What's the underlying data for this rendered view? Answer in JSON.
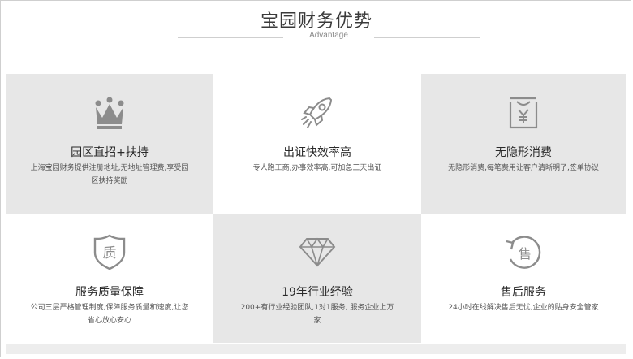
{
  "header": {
    "title": "宝园财务优势",
    "subtitle": "Advantage"
  },
  "features": [
    {
      "title": "园区直招+扶持",
      "desc": "上海宝园财务提供注册地址,无地址管理费,享受园区扶持奖励",
      "icon": "crown-icon"
    },
    {
      "title": "出证快效率高",
      "desc": "专人跑工商,办事效率高,可加急三天出证",
      "icon": "rocket-icon"
    },
    {
      "title": "无隐形消费",
      "desc": "无隐形消费,每笔费用让客户清晰明了,签单协议",
      "icon": "yen-receipt-icon"
    },
    {
      "title": "服务质量保障",
      "desc": "公司三层严格管理制度,保障服务质量和速度,让您省心放心安心",
      "icon": "quality-shield-icon"
    },
    {
      "title": "19年行业经验",
      "desc": "200+有行业经验团队,1对1服务, 服务企业上万家",
      "icon": "diamond-icon"
    },
    {
      "title": "售后服务",
      "desc": "24小时在线解决售后无忧,企业的贴身安全管家",
      "icon": "after-sales-icon"
    }
  ],
  "colors": {
    "gray_cell": "#e7e7e7",
    "icon_gray": "#8c8c8c"
  }
}
